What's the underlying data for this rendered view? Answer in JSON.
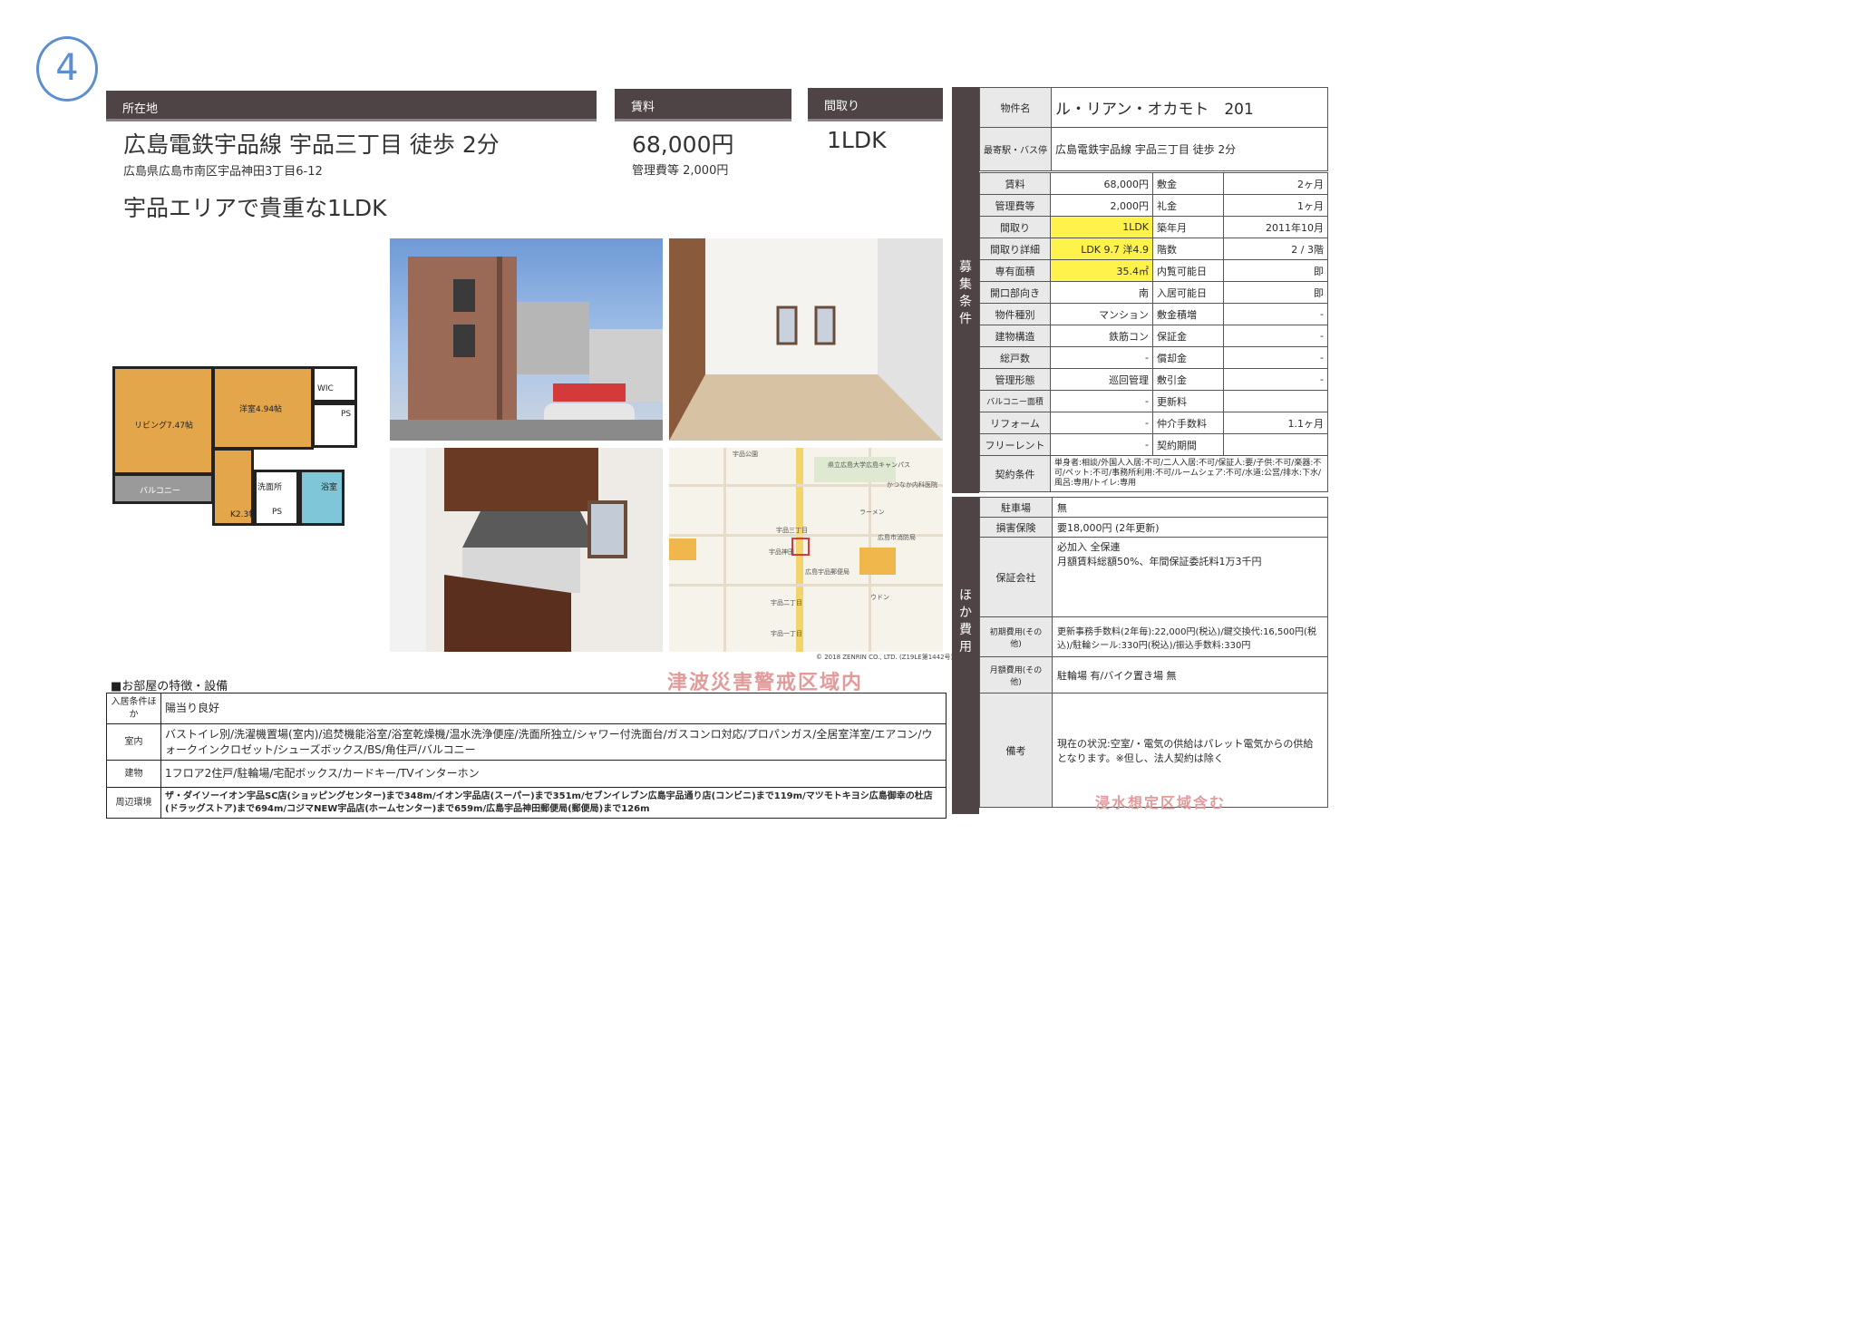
{
  "marker": "4",
  "headers": {
    "location": "所在地",
    "rent": "賃料",
    "layout": "間取り"
  },
  "summary": {
    "station": "広島電鉄宇品線 宇品三丁目 徒歩 2分",
    "address": "広島県広島市南区宇品神田3丁目6-12",
    "catch": "宇品エリアで貴重な1LDK",
    "rent": "68,000円",
    "fee": "管理費等 2,000円",
    "layout": "1LDK"
  },
  "floorplan": {
    "living": "リビング7.47帖",
    "bedroom": "洋室4.94帖",
    "wic": "WIC",
    "ps1": "PS",
    "ps2": "PS",
    "balcony": "バルコニー",
    "washroom": "洗面所",
    "bath": "浴室",
    "kitchen": "K2.3帖"
  },
  "map": {
    "labels": [
      "宇品公園",
      "県立広島大学広島キャンパス",
      "かつなか内科医院",
      "ラーメン",
      "広島市消防局",
      "ウドン",
      "宇品三丁目",
      "広島宇品郵便局",
      "宇品神田",
      "宇品二丁目",
      "宇品一丁目"
    ],
    "copyright": "© 2018 ZENRIN CO., LTD. (Z19LE第1442号)"
  },
  "features": {
    "title": "■お部屋の特徴・設備",
    "rows": [
      {
        "label": "入居条件ほか",
        "value": "陽当り良好"
      },
      {
        "label": "室内",
        "value": "バストイレ別/洗濯機置場(室内)/追焚機能浴室/浴室乾燥機/温水洗浄便座/洗面所独立/シャワー付洗面台/ガスコンロ対応/プロパンガス/全居室洋室/エアコン/ウォークインクロゼット/シューズボックス/BS/角住戸/バルコニー"
      },
      {
        "label": "建物",
        "value": "1フロア2住戸/駐輪場/宅配ボックス/カードキー/TVインターホン"
      },
      {
        "label": "周辺環境",
        "value": "ザ・ダイソーイオン宇品SC店(ショッピングセンター)まで348m/イオン宇品店(スーパー)まで351m/セブンイレブン広島宇品通り店(コンビニ)まで119m/マツモトキヨシ広島御幸の杜店(ドラッグストア)まで694m/コジマNEW宇品店(ホームセンター)まで659m/広島宇品神田郵便局(郵便局)まで126m"
      }
    ]
  },
  "side": {
    "band1": "募集条件",
    "band2": "ほか費用",
    "name_label": "物件名",
    "name": "ル・リアン・オカモト　201",
    "station_label": "最寄駅・バス停",
    "station": "広島電鉄宇品線 宇品三丁目 徒歩 2分",
    "rows": [
      [
        "賃料",
        "68,000円",
        "敷金",
        "2ヶ月"
      ],
      [
        "管理費等",
        "2,000円",
        "礼金",
        "1ヶ月"
      ],
      [
        "間取り",
        "1LDK",
        "築年月",
        "2011年10月"
      ],
      [
        "間取り詳細",
        "LDK 9.7 洋4.9",
        "階数",
        "2 / 3階"
      ],
      [
        "専有面積",
        "35.4㎡",
        "内覧可能日",
        "即"
      ],
      [
        "開口部向き",
        "南",
        "入居可能日",
        "即"
      ],
      [
        "物件種別",
        "マンション",
        "敷金積増",
        "-"
      ],
      [
        "建物構造",
        "鉄筋コン",
        "保証金",
        "-"
      ],
      [
        "総戸数",
        "-",
        "償却金",
        "-"
      ],
      [
        "管理形態",
        "巡回管理",
        "敷引金",
        "-"
      ],
      [
        "バルコニー面積",
        "-",
        "更新料",
        ""
      ],
      [
        "リフォーム",
        "-",
        "仲介手数料",
        "1.1ヶ月"
      ],
      [
        "フリーレント",
        "-",
        "契約期間",
        ""
      ]
    ],
    "contract_label": "契約条件",
    "contract": "単身者:相談/外国人入居:不可/二人入居:不可/保証人:要/子供:不可/楽器:不可/ペット:不可/事務所利用:不可/ルームシェア:不可/水道:公営/排水:下水/風呂:専用/トイレ:専用",
    "other": [
      {
        "label": "駐車場",
        "value": "無"
      },
      {
        "label": "損害保険",
        "value": "要18,000円 (2年更新)"
      },
      {
        "label": "保証会社",
        "value": "必加入 全保連\n月額賃料総額50%、年間保証委託料1万3千円"
      },
      {
        "label": "初期費用(その他)",
        "value": "更新事務手数料(2年毎):22,000円(税込)/鍵交換代:16,500円(税込)/駐輪シール:330円(税込)/振込手数料:330円"
      },
      {
        "label": "月額費用(その他)",
        "value": "駐輪場 有/バイク置き場 無"
      },
      {
        "label": "備考",
        "value": "現在の状況:空室/・電気の供給はパレット電気からの供給となります。※但し、法人契約は除く"
      }
    ]
  },
  "stamps": {
    "s1": "津波災害警戒区域内",
    "s2": "浸水想定区域含む"
  }
}
